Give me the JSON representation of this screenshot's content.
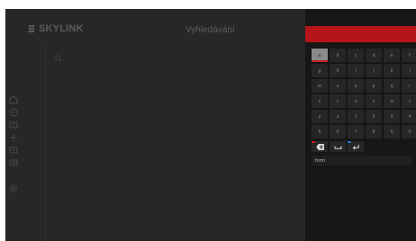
{
  "header": {
    "brand": "SKYLINK",
    "title": "Vyhledávání"
  },
  "nav": {
    "icons": [
      "home-icon",
      "compass-icon",
      "book-icon",
      "plus-icon",
      "tv-icon",
      "recording-icon",
      "settings-icon"
    ]
  },
  "keyboard": {
    "keys": [
      "a",
      "b",
      "c",
      "d",
      "e",
      "f",
      "g",
      "h",
      "i",
      "j",
      "k",
      "l",
      "m",
      "n",
      "o",
      "p",
      "q",
      "r",
      "s",
      "t",
      "u",
      "v",
      "w",
      "x",
      "y",
      "z",
      "1",
      "2",
      "3",
      "4",
      "5",
      "6",
      "7",
      "8",
      "9",
      "0"
    ],
    "selected": "a",
    "function_keys": [
      {
        "name": "backspace-icon",
        "color": "#c81e1e"
      },
      {
        "name": "space-icon",
        "color": "#cccccc"
      },
      {
        "name": "enter-icon",
        "color": "#2a6fd6"
      }
    ]
  },
  "search": {
    "value": "form"
  },
  "colors": {
    "accent": "#b5151a",
    "background": "#272727",
    "panel": "#161616"
  }
}
